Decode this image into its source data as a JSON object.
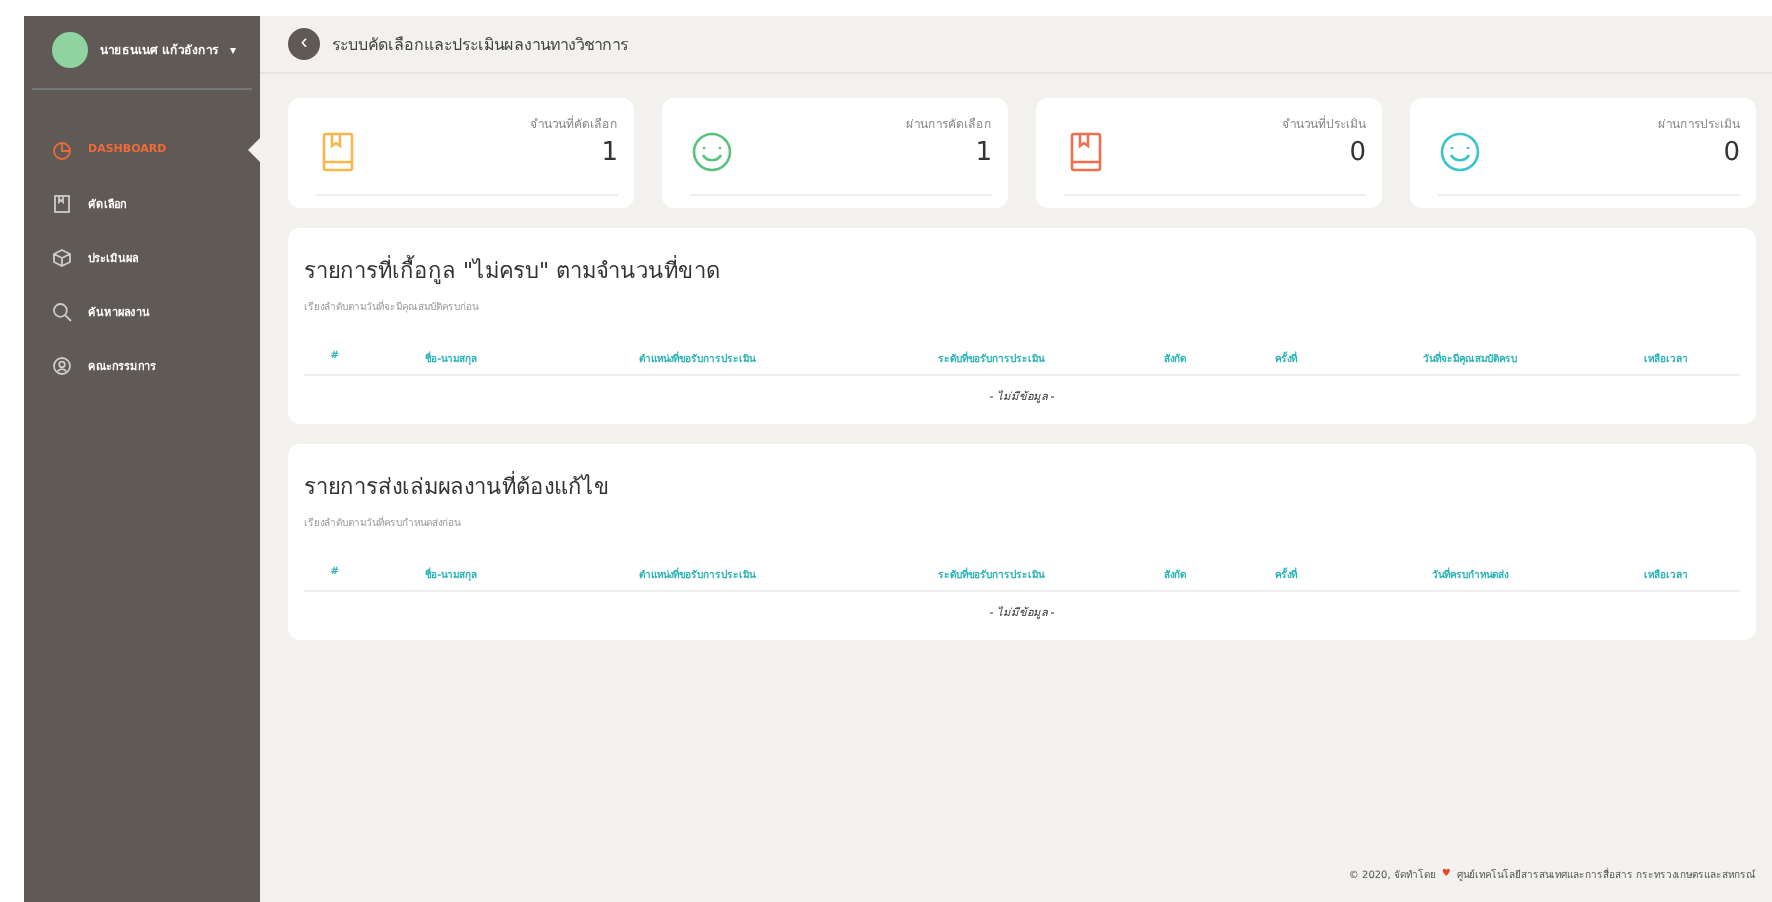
{
  "user": {
    "name": "นายธนเนศ แก้วอังการ",
    "caret": "▾"
  },
  "nav": [
    {
      "label": "DASHBOARD",
      "kind": "chart",
      "selected": true
    },
    {
      "label": "คัดเลือก",
      "kind": "book",
      "selected": false
    },
    {
      "label": "ประเมินผล",
      "kind": "cube",
      "selected": false
    },
    {
      "label": "ค้นหาผลงาน",
      "kind": "search",
      "selected": false
    },
    {
      "label": "คณะกรรมการ",
      "kind": "user",
      "selected": false
    }
  ],
  "header": {
    "back": "‹",
    "title": "ระบบคัดเลือกและประเมินผลงานทางวิชาการ"
  },
  "stats": [
    {
      "label": "จำนวนที่คัดเลือก",
      "value": "1",
      "kind": "book",
      "color": "#f7b74a"
    },
    {
      "label": "ผ่านการคัดเลือก",
      "value": "1",
      "kind": "smile",
      "color": "#5cc37f"
    },
    {
      "label": "จำนวนที่ประเมิน",
      "value": "0",
      "kind": "book",
      "color": "#ef6f4e"
    },
    {
      "label": "ผ่านการประเมิน",
      "value": "0",
      "kind": "smile",
      "color": "#3cc4c9"
    }
  ],
  "tables": [
    {
      "title": "รายการที่เกื้อกูล \"ไม่ครบ\" ตามจำนวนที่ขาด",
      "subtitle": "เรียงลำดับตามวันที่จะมีคุณสมบัติครบก่อน",
      "columns": [
        "#",
        "ชื่อ-นามสกุล",
        "ตำแหน่งที่ขอรับการประเมิน",
        "ระดับที่ขอรับการประเมิน",
        "สังกัด",
        "ครั้งที่",
        "วันที่จะมีคุณสมบัติครบ",
        "เหลือเวลา"
      ],
      "empty": "- ไม่มีข้อมูล -"
    },
    {
      "title": "รายการส่งเล่มผลงานที่ต้องแก้ไข",
      "subtitle": "เรียงลำดับตามวันที่ครบกำหนดส่งก่อน",
      "columns": [
        "#",
        "ชื่อ-นามสกุล",
        "ตำแหน่งที่ขอรับการประเมิน",
        "ระดับที่ขอรับการประเมิน",
        "สังกัด",
        "ครั้งที่",
        "วันที่ครบกำหนดส่ง",
        "เหลือเวลา"
      ],
      "empty": "- ไม่มีข้อมูล -"
    }
  ],
  "footer": {
    "prefix": "© 2020, จัดทำโดย",
    "heart": "♥",
    "org": "ศูนย์เทคโนโลยีสารสนเทศและการสื่อสาร กระทรวงเกษตรและสหกรณ์"
  }
}
